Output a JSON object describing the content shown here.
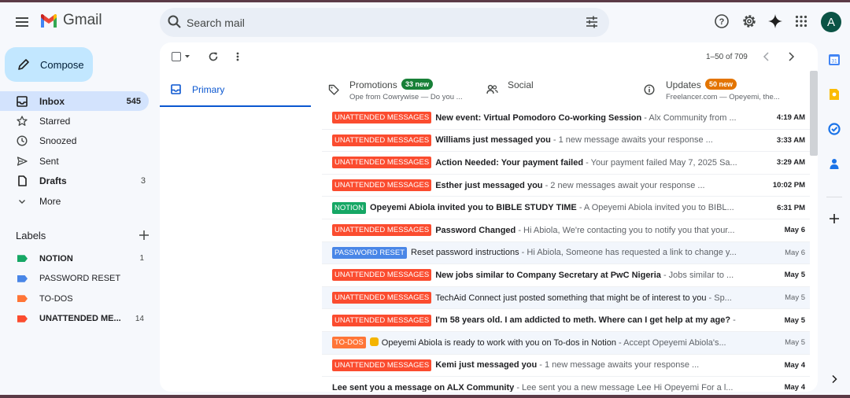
{
  "app": {
    "name": "Gmail"
  },
  "search": {
    "placeholder": "Search mail"
  },
  "user": {
    "initial": "A"
  },
  "compose": {
    "label": "Compose"
  },
  "nav": [
    {
      "label": "Inbox",
      "count": "545",
      "icon": "inbox-icon",
      "active": true,
      "bold": true
    },
    {
      "label": "Starred",
      "count": "",
      "icon": "star-icon"
    },
    {
      "label": "Snoozed",
      "count": "",
      "icon": "clock-icon"
    },
    {
      "label": "Sent",
      "count": "",
      "icon": "send-icon"
    },
    {
      "label": "Drafts",
      "count": "3",
      "icon": "draft-icon",
      "bold": true
    },
    {
      "label": "More",
      "count": "",
      "icon": "chevron-down-icon"
    }
  ],
  "labels": {
    "title": "Labels",
    "items": [
      {
        "name": "NOTION",
        "count": "1",
        "color": "#16a765",
        "bold": true
      },
      {
        "name": "PASSWORD RESET",
        "count": "",
        "color": "#4986e7",
        "bold": false
      },
      {
        "name": "TO-DOS",
        "count": "",
        "color": "#ff7537",
        "bold": false
      },
      {
        "name": "UNATTENDED ME...",
        "count": "14",
        "color": "#fb4c2f",
        "bold": true
      }
    ]
  },
  "toolbar": {
    "range": "1–50 of 709"
  },
  "tabs": {
    "primary": {
      "name": "Primary"
    },
    "promotions": {
      "name": "Promotions",
      "badge": "33 new",
      "badge_color": "#188038",
      "sub": "Ope from Cowrywise — Do you ..."
    },
    "social": {
      "name": "Social"
    },
    "updates": {
      "name": "Updates",
      "badge": "50 new",
      "badge_color": "#e37400",
      "sub": "Freelancer.com — Opeyemi, the..."
    }
  },
  "emails": [
    {
      "label": "UNATTENDED MESSAGES",
      "label_color": "#fb4c2f",
      "subject": "New event: Virtual Pomodoro Co-working Session",
      "snippet": " - Alx Community from ...",
      "time": "4:19 AM",
      "read": false
    },
    {
      "label": "UNATTENDED MESSAGES",
      "label_color": "#fb4c2f",
      "subject": "Williams just messaged you",
      "snippet": " - 1 new message awaits your response  ...",
      "time": "3:33 AM",
      "read": false
    },
    {
      "label": "UNATTENDED MESSAGES",
      "label_color": "#fb4c2f",
      "subject": "Action Needed: Your payment failed",
      "snippet": " - Your payment failed May 7, 2025 Sa...",
      "time": "3:29 AM",
      "read": false
    },
    {
      "label": "UNATTENDED MESSAGES",
      "label_color": "#fb4c2f",
      "subject": "Esther just messaged you",
      "snippet": " - 2 new messages await your response  ...",
      "time": "10:02 PM",
      "read": false
    },
    {
      "label": "NOTION",
      "label_color": "#16a765",
      "subject": "Opeyemi Abiola invited you to BIBLE STUDY TIME",
      "snippet": " - A Opeyemi Abiola invited you to BIBL...",
      "time": "6:31 PM",
      "read": false
    },
    {
      "label": "UNATTENDED MESSAGES",
      "label_color": "#fb4c2f",
      "subject": "Password Changed",
      "snippet": " - Hi Abiola, We're contacting you to notify you that your...",
      "time": "May 6",
      "read": false
    },
    {
      "label": "PASSWORD RESET",
      "label_color": "#4986e7",
      "subject": "Reset password instructions",
      "snippet": " - Hi Abiola, Someone has requested a link to change y...",
      "time": "May 6",
      "read": true
    },
    {
      "label": "UNATTENDED MESSAGES",
      "label_color": "#fb4c2f",
      "subject": "New jobs similar to Company Secretary at PwC Nigeria",
      "snippet": " - Jobs similar to ...",
      "time": "May 5",
      "read": false
    },
    {
      "label": "UNATTENDED MESSAGES",
      "label_color": "#fb4c2f",
      "subject": "TechAid Connect just posted something that might be of interest to you",
      "snippet": " - Sp...",
      "time": "May 5",
      "read": true
    },
    {
      "label": "UNATTENDED MESSAGES",
      "label_color": "#fb4c2f",
      "subject": "I'm 58 years old. I am addicted to meth. Where can I get help at my age?",
      "snippet": " -",
      "time": "May 5",
      "read": false
    },
    {
      "label": "TO-DOS",
      "label_color": "#ff7537",
      "emoji": true,
      "subject": "Opeyemi Abiola is ready to work with you on To-dos in Notion",
      "snippet": " - Accept Opeyemi Abiola's...",
      "time": "May 5",
      "read": true
    },
    {
      "label": "UNATTENDED MESSAGES",
      "label_color": "#fb4c2f",
      "subject": "Kemi just messaged you",
      "snippet": " - 1 new message awaits your response  ...",
      "time": "May 4",
      "read": false
    },
    {
      "label": "",
      "label_color": "",
      "subject": "Lee sent you a message on ALX Community",
      "snippet": " - Lee sent you a new message Lee Hi Opeyemi For a l...",
      "time": "May 4",
      "read": false
    }
  ]
}
